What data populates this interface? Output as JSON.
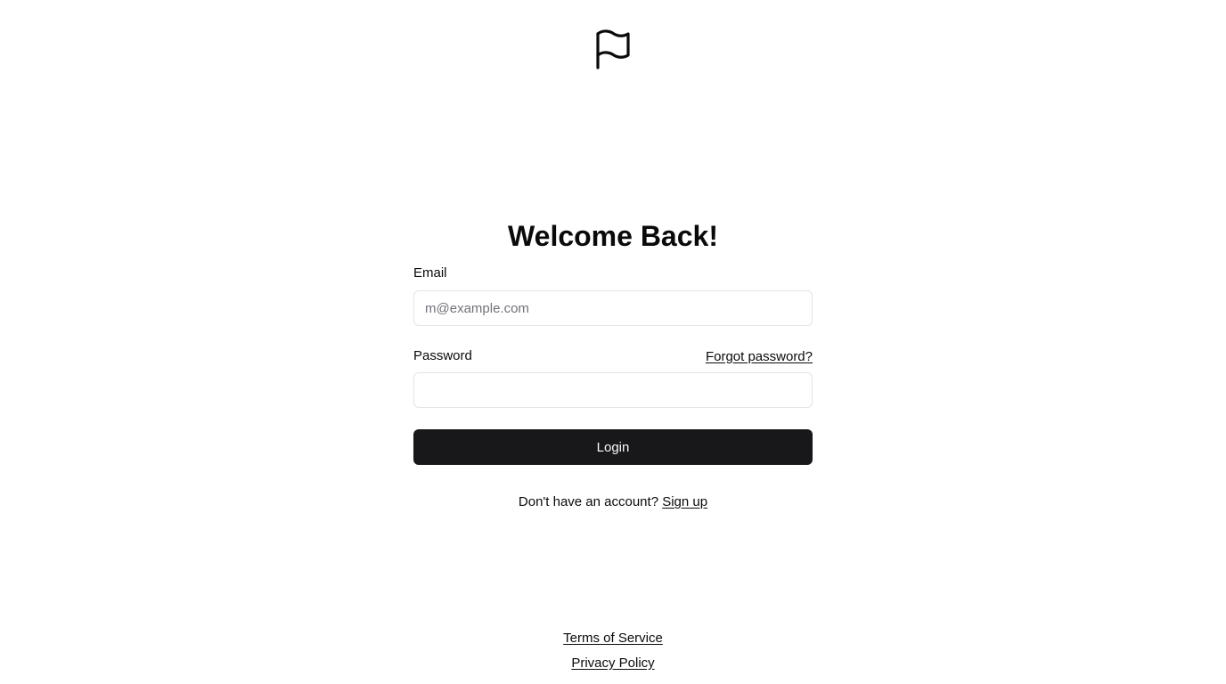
{
  "logo": {
    "icon": "flag-icon"
  },
  "heading": "Welcome Back!",
  "email": {
    "label": "Email",
    "placeholder": "m@example.com",
    "value": ""
  },
  "password": {
    "label": "Password",
    "forgot_link": "Forgot password?",
    "value": ""
  },
  "login_button": "Login",
  "signup": {
    "prompt": "Don't have an account?",
    "link": "Sign up"
  },
  "footer": {
    "terms": "Terms of Service",
    "privacy": "Privacy Policy"
  },
  "colors": {
    "button_bg": "#18181b",
    "button_text": "#fafafa",
    "border": "#e4e4e7",
    "placeholder": "#71717a",
    "text": "#0a0a0a"
  }
}
